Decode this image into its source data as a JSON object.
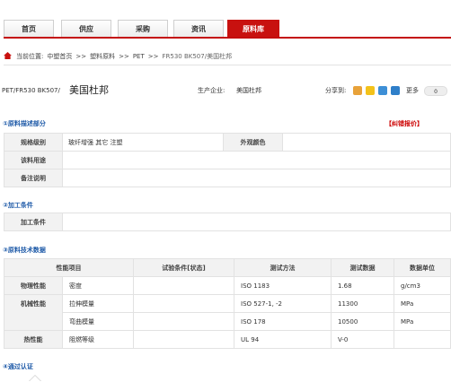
{
  "nav": {
    "tabs": [
      {
        "label": "首页",
        "active": false
      },
      {
        "label": "供应",
        "active": false
      },
      {
        "label": "采购",
        "active": false
      },
      {
        "label": "资讯",
        "active": false
      },
      {
        "label": "原料库",
        "active": true
      }
    ]
  },
  "breadcrumb": {
    "prefix": "当前位置:",
    "items": [
      "中塑首页",
      ">>",
      "塑料原料",
      ">>",
      "PET",
      ">>",
      "FR530 BK507/美国杜邦"
    ]
  },
  "product": {
    "code": "PET/FR530 BK507/",
    "maker": "美国杜邦",
    "enterprise_label": "生产企业:",
    "enterprise_value": "美国杜邦",
    "share_label": "分享到:",
    "more_label": "更多",
    "share_count": "0"
  },
  "colors": {
    "accent": "#c8110f",
    "section": "#1e5aa8"
  },
  "sections": {
    "desc": "①原料描述部分",
    "error_report": "【纠错报价】",
    "process": "②加工条件",
    "tech": "③原料技术数据",
    "cert": "④通过认证"
  },
  "desc_table": {
    "spec_label": "规格级别",
    "spec_value": "玻纤增强 其它 注塑",
    "color_label": "外观颜色",
    "color_value": "",
    "usage_label": "该料用途",
    "usage_value": "",
    "note_label": "备注说明",
    "note_value": ""
  },
  "process_table": {
    "label": "加工条件",
    "value": ""
  },
  "tech_table": {
    "headers": [
      "性能项目",
      "试验条件[状态]",
      "测试方法",
      "测试数据",
      "数据单位"
    ],
    "rows": [
      {
        "cat": "物理性能",
        "item": "密度",
        "cond": "",
        "method": "ISO 1183",
        "data": "1.68",
        "unit": "g/cm3"
      },
      {
        "cat": "机械性能",
        "item": "拉伸模量",
        "cond": "",
        "method": "ISO 527-1, -2",
        "data": "11300",
        "unit": "MPa"
      },
      {
        "cat": "",
        "item": "弯曲模量",
        "cond": "",
        "method": "ISO 178",
        "data": "10500",
        "unit": "MPa"
      },
      {
        "cat": "热性能",
        "item": "阻燃等级",
        "cond": "",
        "method": "UL 94",
        "data": "V-0",
        "unit": ""
      }
    ]
  }
}
